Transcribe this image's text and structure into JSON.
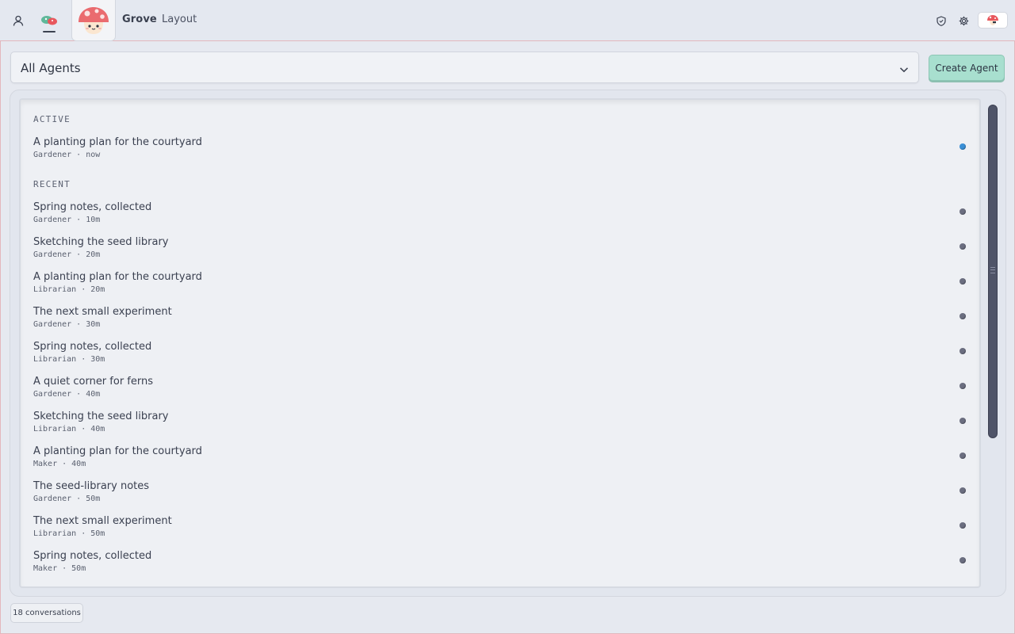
{
  "header": {
    "tabs": [
      {
        "label": "Grove"
      },
      {
        "label": "Layout"
      }
    ],
    "icons": {
      "user": "user-icon",
      "app": "mushroom-icon",
      "shield": "shield-icon",
      "settings": "gear-icon",
      "profile": "mushroom-avatar-icon"
    }
  },
  "toolbar": {
    "agent_filter": "All Agents",
    "create_label": "Create Agent"
  },
  "conversations": {
    "active_label": "ACTIVE",
    "recent_label": "RECENT",
    "active": [
      {
        "title": "A planting plan for the courtyard",
        "meta": "Gardener · now"
      }
    ],
    "recent": [
      {
        "title": "Spring notes, collected",
        "meta": "Gardener · 10m"
      },
      {
        "title": "Sketching the seed library",
        "meta": "Gardener · 20m"
      },
      {
        "title": "A planting plan for the courtyard",
        "meta": "Librarian · 20m"
      },
      {
        "title": "The next small experiment",
        "meta": "Gardener · 30m"
      },
      {
        "title": "Spring notes, collected",
        "meta": "Librarian · 30m"
      },
      {
        "title": "A quiet corner for ferns",
        "meta": "Gardener · 40m"
      },
      {
        "title": "Sketching the seed library",
        "meta": "Librarian · 40m"
      },
      {
        "title": "A planting plan for the courtyard",
        "meta": "Maker · 40m"
      },
      {
        "title": "The seed-library notes",
        "meta": "Gardener · 50m"
      },
      {
        "title": "The next small experiment",
        "meta": "Librarian · 50m"
      },
      {
        "title": "Spring notes, collected",
        "meta": "Maker · 50m"
      }
    ]
  },
  "footer": {
    "count": "18 conversations"
  },
  "colors": {
    "accent": "#a8dfcf",
    "active_dot": "#3a8fd6",
    "idle_dot": "#6b6e80",
    "mushroom_red": "#e8575d"
  }
}
